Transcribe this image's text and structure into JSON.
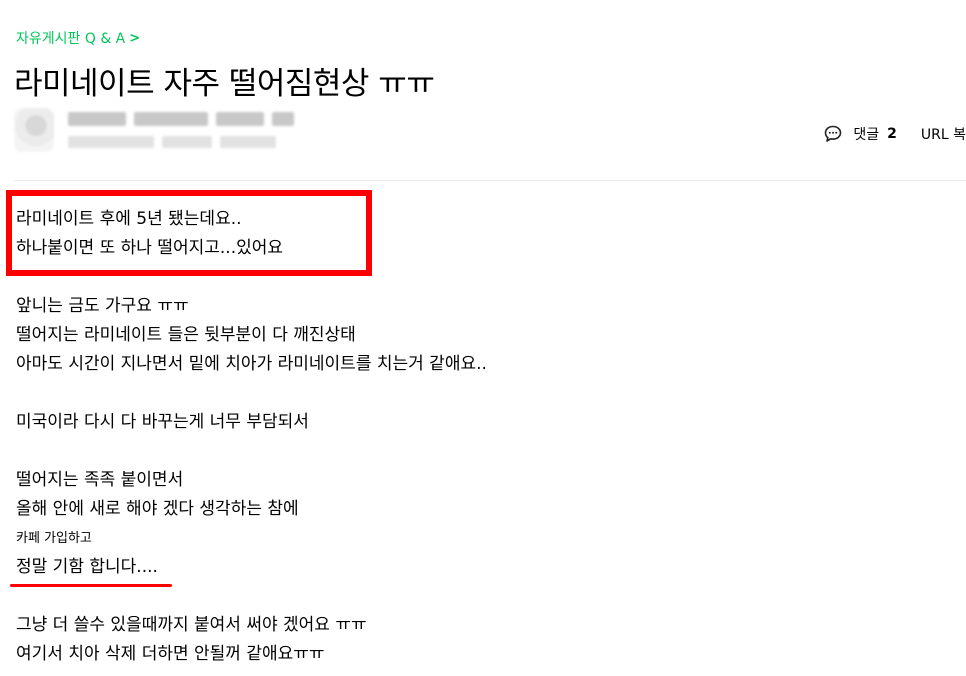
{
  "breadcrumb": {
    "label": "자유게시판 Q & A",
    "chevron": ">"
  },
  "post": {
    "title": "라미네이트 자주 떨어짐현상 ㅠㅠ",
    "comment_label": "댓글",
    "comment_count": "2",
    "url_copy_label": "URL 복"
  },
  "body_lines": [
    "라미네이트 후에 5년 됐는데요..",
    "하나붙이면 또 하나 떨어지고...있어요",
    "",
    "앞니는 금도 가구요 ㅠㅠ",
    "떨어지는 라미네이트 들은 뒷부분이 다 깨진상태",
    "아마도 시간이 지나면서 밑에 치아가 라미네이트를 치는거 같애요..",
    "",
    "미국이라 다시 다 바꾸는게 너무 부담되서",
    "",
    "떨어지는 족족 붙이면서",
    "올해 안에 새로 해야 겠다 생각하는 참에",
    "카페 가입하고",
    "정말 기함 합니다....",
    "",
    "그냥 더 쓸수 있을때까지 붙여서 써야 겠어요 ㅠㅠ",
    "여기서 치아 삭제 더하면 안될꺼 같애요ㅠㅠ"
  ],
  "colors": {
    "accent": "#03c75a",
    "annotation": "#ff0000"
  },
  "icons": {
    "comment": "comment-bubble-icon",
    "breadcrumb": "chevron-right-icon"
  }
}
